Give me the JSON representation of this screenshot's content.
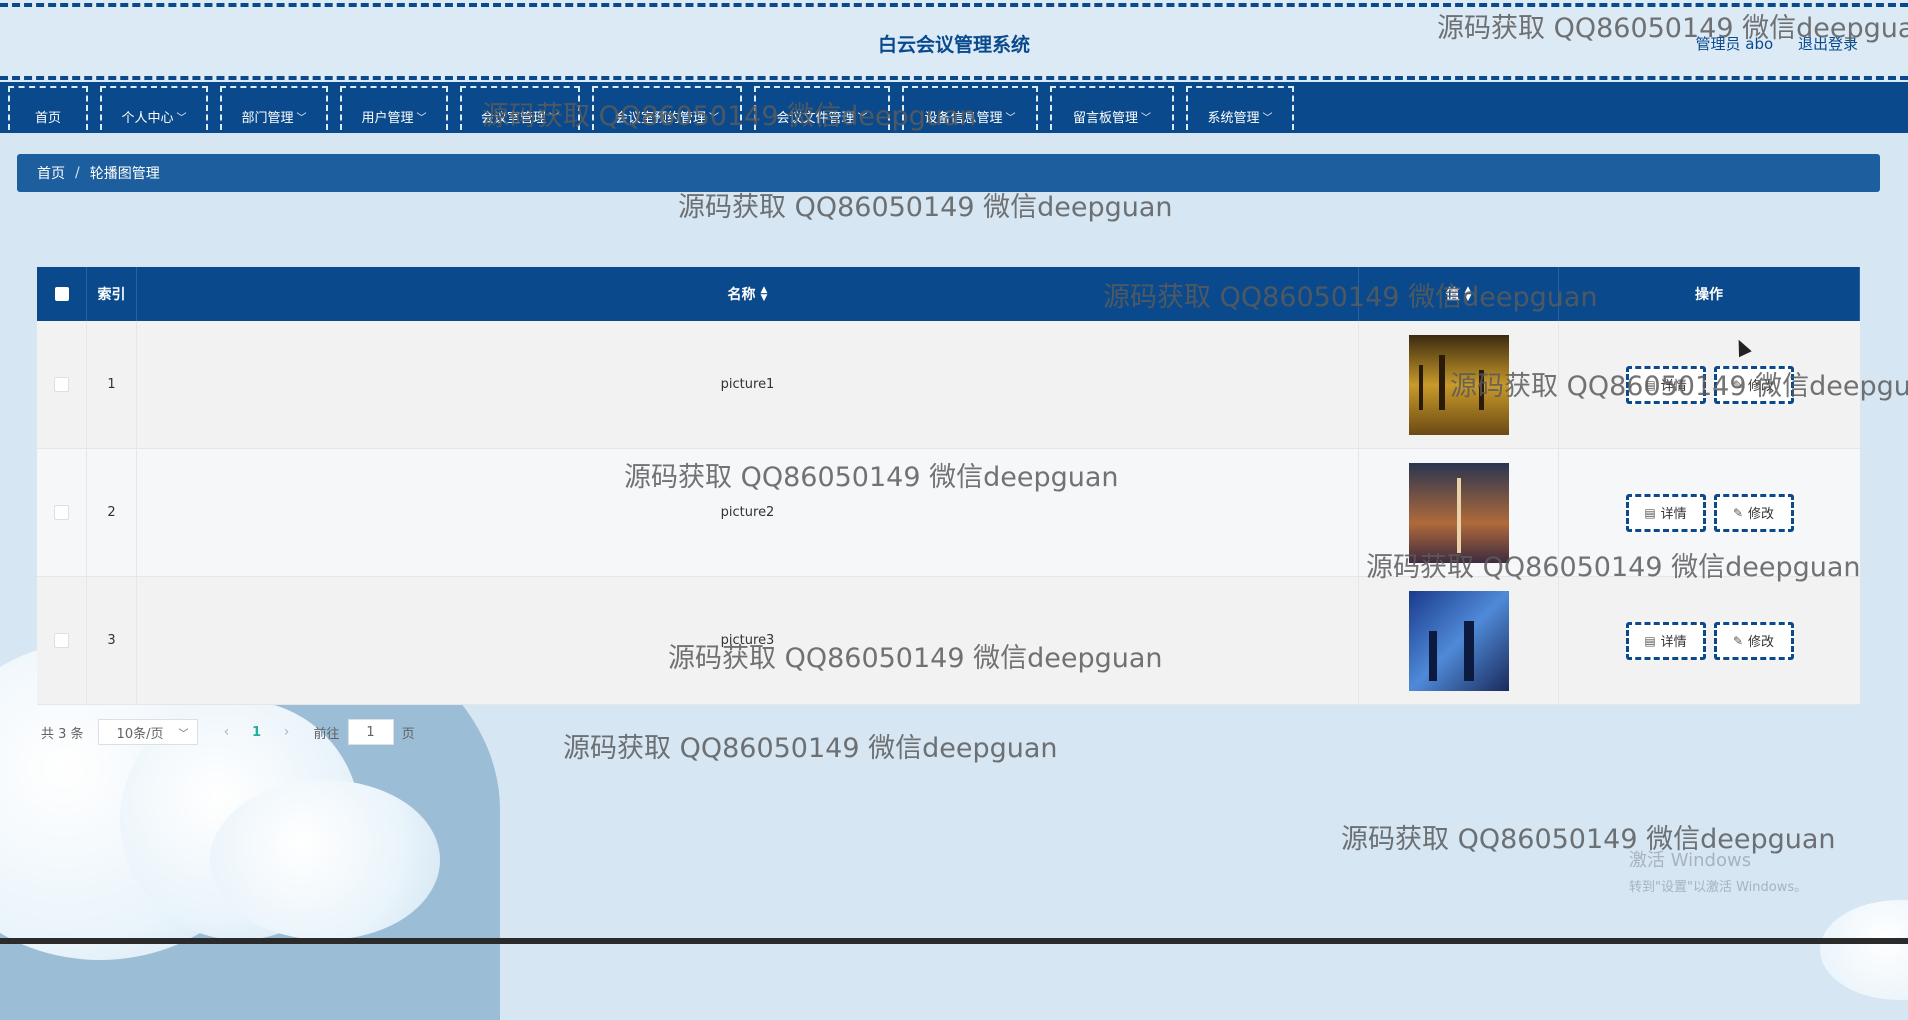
{
  "app": {
    "title": "白云会议管理系统",
    "user_label": "管理员 abo",
    "logout_label": "退出登录"
  },
  "nav": {
    "items": [
      {
        "label": "首页",
        "has_dropdown": false
      },
      {
        "label": "个人中心",
        "has_dropdown": true
      },
      {
        "label": "部门管理",
        "has_dropdown": true
      },
      {
        "label": "用户管理",
        "has_dropdown": true
      },
      {
        "label": "会议室管理",
        "has_dropdown": true
      },
      {
        "label": "会议室预约管理",
        "has_dropdown": true
      },
      {
        "label": "会议文件管理",
        "has_dropdown": true
      },
      {
        "label": "设备信息管理",
        "has_dropdown": true
      },
      {
        "label": "留言板管理",
        "has_dropdown": true
      },
      {
        "label": "系统管理",
        "has_dropdown": true
      }
    ]
  },
  "breadcrumb": {
    "home": "首页",
    "separator": "/",
    "current": "轮播图管理"
  },
  "table": {
    "headers": {
      "index": "索引",
      "name": "名称",
      "value": "值",
      "ops": "操作"
    },
    "rows": [
      {
        "index": "1",
        "name": "picture1",
        "thumb_colors": [
          "#3a2a10",
          "#c89a2a",
          "#6b4a14"
        ]
      },
      {
        "index": "2",
        "name": "picture2",
        "thumb_colors": [
          "#2a3550",
          "#b06a3a",
          "#3d2a40"
        ]
      },
      {
        "index": "3",
        "name": "picture3",
        "thumb_colors": [
          "#1b3a8c",
          "#4f8ad8",
          "#1a2a5a"
        ]
      }
    ],
    "detail_label": "详情",
    "edit_label": "修改"
  },
  "pagination": {
    "total_text": "共 3 条",
    "page_size": "10条/页",
    "current_page": "1",
    "goto_prefix": "前往",
    "goto_value": "1",
    "goto_suffix": "页"
  },
  "watermark": {
    "text": "源码获取 QQ86050149 微信deepguan"
  },
  "os_notice": {
    "line1": "激活 Windows",
    "line2": "转到\"设置\"以激活 Windows。"
  },
  "colors": {
    "primary": "#0a4a8c",
    "breadcrumb": "#1d5f9e",
    "background": "#d6e6f3",
    "page_active": "#1fb19e"
  }
}
